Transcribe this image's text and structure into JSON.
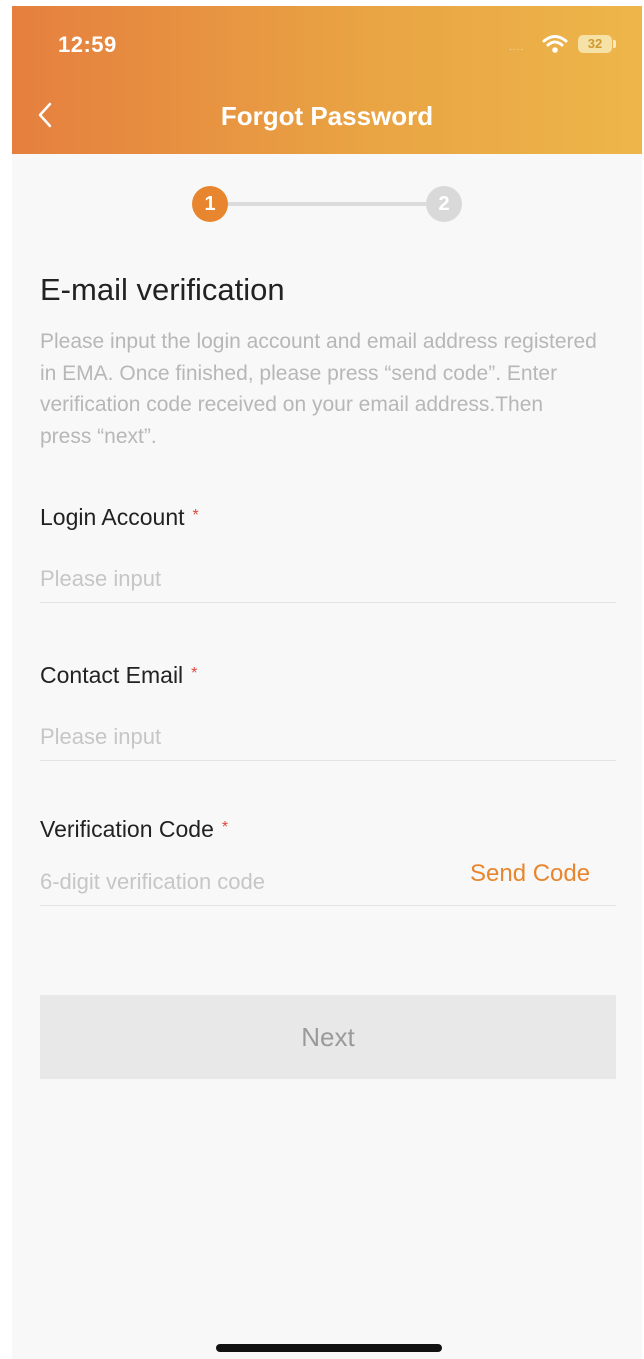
{
  "status_bar": {
    "time": "12:59",
    "signal": "....",
    "battery": "32",
    "icons": [
      "wifi-icon",
      "battery-icon"
    ]
  },
  "header": {
    "title": "Forgot Password",
    "back_icon": "chevron-left-icon",
    "gradient": [
      "#e57f3f",
      "#edb64a"
    ]
  },
  "stepper": {
    "steps": [
      "1",
      "2"
    ],
    "active_step": 1,
    "active_color": "#e8862f",
    "inactive_color": "#d9d9d9"
  },
  "section": {
    "title": "E-mail verification",
    "description": "Please input the login account and email address registered in EMA. Once finished, please press “send code”. Enter verification code received on your email address.Then press “next”."
  },
  "form": {
    "login_account": {
      "label": "Login Account",
      "required": "*",
      "placeholder": "Please input",
      "value": ""
    },
    "contact_email": {
      "label": "Contact Email",
      "required": "*",
      "placeholder": "Please input",
      "value": ""
    },
    "verification_code": {
      "label": "Verification Code",
      "required": "*",
      "placeholder": "6-digit verification code",
      "value": "",
      "send_code_label": "Send Code"
    }
  },
  "actions": {
    "next_label": "Next"
  },
  "colors": {
    "accent": "#e8862f",
    "required": "#e0473a",
    "disabled_button": "#e8e8e8"
  }
}
